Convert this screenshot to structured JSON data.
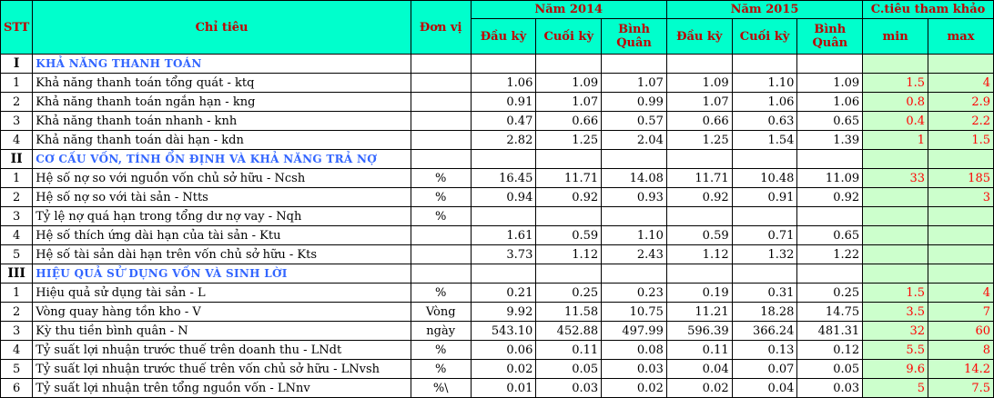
{
  "header": {
    "stt": "STT",
    "chi_tieu": "Chỉ tiêu",
    "don_vi": "Đơn vị",
    "group_2014": "Năm 2014",
    "group_2015": "Năm 2015",
    "group_ref": "C.tiêu tham khảo",
    "dau_ky": "Đầu kỳ",
    "cuoi_ky": "Cuối kỳ",
    "binh_quan": "Bình Quân",
    "min": "min",
    "max": "max"
  },
  "rows": [
    {
      "type": "section",
      "stt": "I",
      "name": "KHẢ NĂNG THANH TOÁN"
    },
    {
      "type": "item",
      "stt": "1",
      "name": "Khả năng thanh toán tổng quát - ktq",
      "unit": "",
      "v": [
        "1.06",
        "1.09",
        "1.07",
        "1.09",
        "1.10",
        "1.09"
      ],
      "min": "1.5",
      "max": "4"
    },
    {
      "type": "item",
      "stt": "2",
      "name": "Khả năng thanh toán ngắn hạn - kng",
      "unit": "",
      "v": [
        "0.91",
        "1.07",
        "0.99",
        "1.07",
        "1.06",
        "1.06"
      ],
      "min": "0.8",
      "max": "2.9"
    },
    {
      "type": "item",
      "stt": "3",
      "name": "Khả năng thanh toán nhanh - knh",
      "unit": "",
      "v": [
        "0.47",
        "0.66",
        "0.57",
        "0.66",
        "0.63",
        "0.65"
      ],
      "min": "0.4",
      "max": "2.2"
    },
    {
      "type": "item",
      "stt": "4",
      "name": "Khả năng thanh toán dài hạn - kdn",
      "unit": "",
      "v": [
        "2.82",
        "1.25",
        "2.04",
        "1.25",
        "1.54",
        "1.39"
      ],
      "min": "1",
      "max": "1.5"
    },
    {
      "type": "section",
      "stt": "II",
      "name": "CƠ CẤU VỐN, TÍNH ỔN ĐỊNH VÀ KHẢ NĂNG TRẢ NỢ"
    },
    {
      "type": "item",
      "stt": "1",
      "name": "Hệ số nợ so với nguồn vốn chủ sở hữu - Ncsh",
      "unit": "%",
      "v": [
        "16.45",
        "11.71",
        "14.08",
        "11.71",
        "10.48",
        "11.09"
      ],
      "min": "33",
      "max": "185"
    },
    {
      "type": "item",
      "stt": "2",
      "name": "Hệ số nợ so với tài sản - Ntts",
      "unit": "%",
      "v": [
        "0.94",
        "0.92",
        "0.93",
        "0.92",
        "0.91",
        "0.92"
      ],
      "min": "",
      "max": "3"
    },
    {
      "type": "item",
      "stt": "3",
      "name": "Tỷ lệ nợ quá hạn trong tổng dư nợ vay - Nqh",
      "unit": "%",
      "v": [
        "",
        "",
        "",
        "",
        "",
        ""
      ],
      "min": "",
      "max": ""
    },
    {
      "type": "item",
      "stt": "4",
      "name": "Hệ số thích ứng dài hạn của tài sản - Ktu",
      "unit": "",
      "v": [
        "1.61",
        "0.59",
        "1.10",
        "0.59",
        "0.71",
        "0.65"
      ],
      "min": "",
      "max": ""
    },
    {
      "type": "item",
      "stt": "5",
      "name": "Hệ số tài sản dài hạn trên vốn chủ sở hữu - Kts",
      "unit": "",
      "v": [
        "3.73",
        "1.12",
        "2.43",
        "1.12",
        "1.32",
        "1.22"
      ],
      "min": "",
      "max": ""
    },
    {
      "type": "section",
      "stt": "III",
      "name": "HIỆU QUẢ SỬ DỤNG VỐN VÀ SINH LỜI"
    },
    {
      "type": "item",
      "stt": "1",
      "name": "Hiệu quả sử dụng tài sản - L",
      "unit": "%",
      "v": [
        "0.21",
        "0.25",
        "0.23",
        "0.19",
        "0.31",
        "0.25"
      ],
      "min": "1.5",
      "max": "4"
    },
    {
      "type": "item",
      "stt": "2",
      "name": "Vòng quay hàng tồn kho - V",
      "unit": "Vòng",
      "v": [
        "9.92",
        "11.58",
        "10.75",
        "11.21",
        "18.28",
        "14.75"
      ],
      "min": "3.5",
      "max": "7"
    },
    {
      "type": "item",
      "stt": "3",
      "name": "Kỳ thu tiền bình quân - N",
      "unit": "ngày",
      "v": [
        "543.10",
        "452.88",
        "497.99",
        "596.39",
        "366.24",
        "481.31"
      ],
      "min": "32",
      "max": "60"
    },
    {
      "type": "item",
      "stt": "4",
      "name": "Tỷ suất lợi nhuận trước thuế trên doanh thu - LNdt",
      "unit": "%",
      "v": [
        "0.06",
        "0.11",
        "0.08",
        "0.11",
        "0.13",
        "0.12"
      ],
      "min": "5.5",
      "max": "8"
    },
    {
      "type": "item",
      "stt": "5",
      "name": "Tỷ suất lợi nhuận trước thuế trên vốn chủ sở hữu - LNvsh",
      "unit": "%",
      "v": [
        "0.02",
        "0.05",
        "0.03",
        "0.04",
        "0.07",
        "0.05"
      ],
      "min": "9.6",
      "max": "14.2"
    },
    {
      "type": "item",
      "stt": "6",
      "name": "Tỷ suất lợi nhuận trên tổng nguồn vốn - LNnv",
      "unit": "%\\",
      "v": [
        "0.01",
        "0.03",
        "0.02",
        "0.02",
        "0.04",
        "0.03"
      ],
      "min": "5",
      "max": "7.5"
    }
  ]
}
